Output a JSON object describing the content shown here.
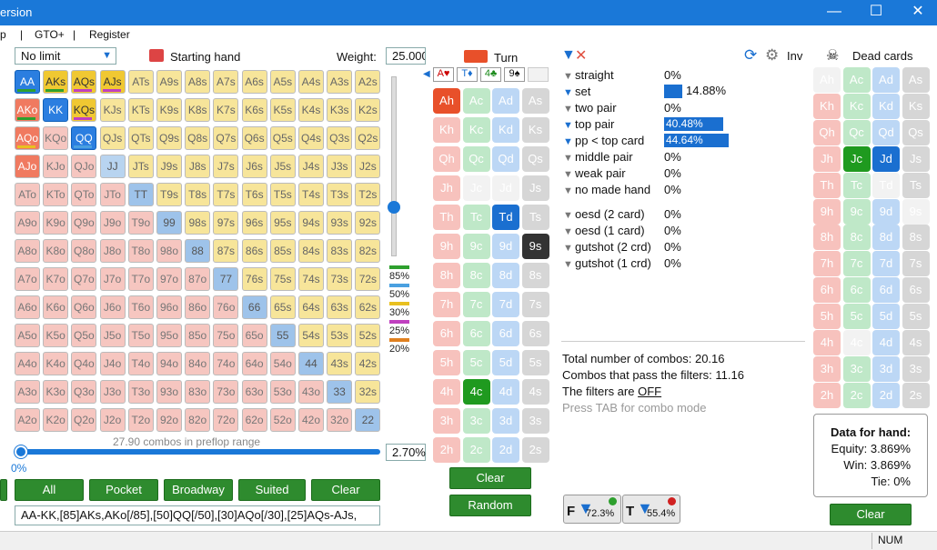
{
  "window": {
    "title": "ersion",
    "min": "—",
    "max": "☐",
    "close": "✕"
  },
  "menu": [
    "p",
    "|",
    "GTO+",
    "|",
    "Register"
  ],
  "left": {
    "mode": "No limit",
    "starting_hand_label": "Starting hand",
    "weight_label": "Weight:",
    "weight_value": "25.000",
    "combos_text": "27.90 combos in preflop range",
    "pct_value": "2.70%",
    "slider_pct": "0%",
    "legend": [
      "85%",
      "50%",
      "30%",
      "25%",
      "20%"
    ],
    "buttons": [
      "All",
      "Pocket",
      "Broadway",
      "Suited",
      "Clear"
    ],
    "range_text": "AA-KK,[85]AKs,AKo[/85],[50]QQ[/50],[30]AQo[/30],[25]AQs-AJs,"
  },
  "turn": {
    "title": "Turn",
    "board": [
      "A♥",
      "T♦",
      "4♣",
      "9♠",
      ""
    ],
    "clear": "Clear",
    "random": "Random",
    "filter1": "72.3%",
    "filter2": "55.4%",
    "filter1_letter": "F",
    "filter2_letter": "T"
  },
  "filters": {
    "inv_label": "Inv",
    "rows": [
      {
        "name": "straight",
        "pct": "0%"
      },
      {
        "name": "set",
        "pct": "14.88%",
        "bar": 0.149
      },
      {
        "name": "two pair",
        "pct": "0%"
      },
      {
        "name": "top pair",
        "pct": "40.48%",
        "bar": 0.405
      },
      {
        "name": "pp < top card",
        "pct": "44.64%",
        "bar": 0.446
      },
      {
        "name": "middle pair",
        "pct": "0%"
      },
      {
        "name": "weak pair",
        "pct": "0%"
      },
      {
        "name": "no made hand",
        "pct": "0%"
      }
    ],
    "draws": [
      {
        "name": "oesd (2 card)",
        "pct": "0%"
      },
      {
        "name": "oesd (1 card)",
        "pct": "0%"
      },
      {
        "name": "gutshot (2 crd)",
        "pct": "0%"
      },
      {
        "name": "gutshot (1 crd)",
        "pct": "0%"
      }
    ],
    "total": "Total number of combos: 20.16",
    "pass": "Combos that pass the filters: 11.16",
    "filters_off_prefix": "The filters are",
    "filters_off": "OFF",
    "tab_hint": "Press TAB for combo mode"
  },
  "dead": {
    "title": "Dead cards",
    "data_title": "Data for hand:",
    "equity": "Equity: 3.869%",
    "win": "Win: 3.869%",
    "tie": "Tie: 0%",
    "clear": "Clear"
  },
  "status": {
    "num": "NUM"
  },
  "grid": [
    [
      "AA",
      "AKs",
      "AQs",
      "AJs",
      "ATs",
      "A9s",
      "A8s",
      "A7s",
      "A6s",
      "A5s",
      "A4s",
      "A3s",
      "A2s"
    ],
    [
      "AKo",
      "KK",
      "KQs",
      "KJs",
      "KTs",
      "K9s",
      "K8s",
      "K7s",
      "K6s",
      "K5s",
      "K4s",
      "K3s",
      "K2s"
    ],
    [
      "AQo",
      "KQo",
      "QQ",
      "QJs",
      "QTs",
      "Q9s",
      "Q8s",
      "Q7s",
      "Q6s",
      "Q5s",
      "Q4s",
      "Q3s",
      "Q2s"
    ],
    [
      "AJo",
      "KJo",
      "QJo",
      "JJ",
      "JTs",
      "J9s",
      "J8s",
      "J7s",
      "J6s",
      "J5s",
      "J4s",
      "J3s",
      "J2s"
    ],
    [
      "ATo",
      "KTo",
      "QTo",
      "JTo",
      "TT",
      "T9s",
      "T8s",
      "T7s",
      "T6s",
      "T5s",
      "T4s",
      "T3s",
      "T2s"
    ],
    [
      "A9o",
      "K9o",
      "Q9o",
      "J9o",
      "T9o",
      "99",
      "98s",
      "97s",
      "96s",
      "95s",
      "94s",
      "93s",
      "92s"
    ],
    [
      "A8o",
      "K8o",
      "Q8o",
      "J8o",
      "T8o",
      "98o",
      "88",
      "87s",
      "86s",
      "85s",
      "84s",
      "83s",
      "82s"
    ],
    [
      "A7o",
      "K7o",
      "Q7o",
      "J7o",
      "T7o",
      "97o",
      "87o",
      "77",
      "76s",
      "75s",
      "74s",
      "73s",
      "72s"
    ],
    [
      "A6o",
      "K6o",
      "Q6o",
      "J6o",
      "T6o",
      "96o",
      "86o",
      "76o",
      "66",
      "65s",
      "64s",
      "63s",
      "62s"
    ],
    [
      "A5o",
      "K5o",
      "Q5o",
      "J5o",
      "T5o",
      "95o",
      "85o",
      "75o",
      "65o",
      "55",
      "54s",
      "53s",
      "52s"
    ],
    [
      "A4o",
      "K4o",
      "Q4o",
      "J4o",
      "T4o",
      "94o",
      "84o",
      "74o",
      "64o",
      "54o",
      "44",
      "43s",
      "42s"
    ],
    [
      "A3o",
      "K3o",
      "Q3o",
      "J3o",
      "T3o",
      "93o",
      "83o",
      "73o",
      "63o",
      "53o",
      "43o",
      "33",
      "32s"
    ],
    [
      "A2o",
      "K2o",
      "Q2o",
      "J2o",
      "T2o",
      "92o",
      "82o",
      "72o",
      "62o",
      "52o",
      "42o",
      "32o",
      "22"
    ]
  ],
  "turn_cards": [
    [
      "Ah",
      "Ac",
      "Ad",
      "As"
    ],
    [
      "Kh",
      "Kc",
      "Kd",
      "Ks"
    ],
    [
      "Qh",
      "Qc",
      "Qd",
      "Qs"
    ],
    [
      "Jh",
      "Jc",
      "Jd",
      "Js"
    ],
    [
      "Th",
      "Tc",
      "Td",
      "Ts"
    ],
    [
      "9h",
      "9c",
      "9d",
      "9s"
    ],
    [
      "8h",
      "8c",
      "8d",
      "8s"
    ],
    [
      "7h",
      "7c",
      "7d",
      "7s"
    ],
    [
      "6h",
      "6c",
      "6d",
      "6s"
    ],
    [
      "5h",
      "5c",
      "5d",
      "5s"
    ],
    [
      "4h",
      "4c",
      "4d",
      "4s"
    ],
    [
      "3h",
      "3c",
      "3d",
      "3s"
    ],
    [
      "2h",
      "2c",
      "2d",
      "2s"
    ]
  ],
  "dead_cards": [
    [
      "Ah",
      "Ac",
      "Ad",
      "As"
    ],
    [
      "Kh",
      "Kc",
      "Kd",
      "Ks"
    ],
    [
      "Qh",
      "Qc",
      "Qd",
      "Qs"
    ],
    [
      "Jh",
      "Jc",
      "Jd",
      "Js"
    ],
    [
      "Th",
      "Tc",
      "Td",
      "Ts"
    ],
    [
      "9h",
      "9c",
      "9d",
      "9s"
    ],
    [
      "8h",
      "8c",
      "8d",
      "8s"
    ],
    [
      "7h",
      "7c",
      "7d",
      "7s"
    ],
    [
      "6h",
      "6c",
      "6d",
      "6s"
    ],
    [
      "5h",
      "5c",
      "5d",
      "5s"
    ],
    [
      "4h",
      "4c",
      "4d",
      "4s"
    ],
    [
      "3h",
      "3c",
      "3d",
      "3s"
    ],
    [
      "2h",
      "2c",
      "2d",
      "2s"
    ]
  ],
  "colors": {
    "accent": "#1a78d8",
    "green": "#2e8b2e"
  }
}
